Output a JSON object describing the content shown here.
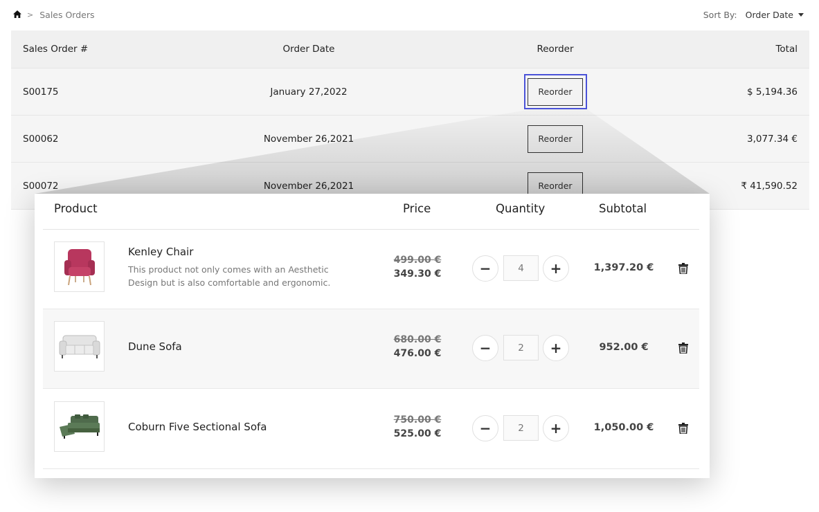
{
  "breadcrumb": {
    "home_icon": "home-icon",
    "separator": ">",
    "current": "Sales Orders"
  },
  "sort": {
    "label": "Sort By:",
    "value": "Order Date"
  },
  "orders": {
    "headers": {
      "number": "Sales Order #",
      "date": "Order Date",
      "reorder": "Reorder",
      "total": "Total"
    },
    "rows": [
      {
        "number": "S00175",
        "date": "January 27,2022",
        "reorder_label": "Reorder",
        "total": "$ 5,194.36"
      },
      {
        "number": "S00062",
        "date": "November 26,2021",
        "reorder_label": "Reorder",
        "total": "3,077.34 €"
      },
      {
        "number": "S00072",
        "date": "November 26,2021",
        "reorder_label": "Reorder",
        "total": "₹ 41,590.52"
      }
    ]
  },
  "cart": {
    "headers": {
      "product": "Product",
      "price": "Price",
      "quantity": "Quantity",
      "subtotal": "Subtotal"
    },
    "items": [
      {
        "name": "Kenley Chair",
        "description": "This product not only comes with an Aesthetic Design but is also comfortable and ergonomic.",
        "old_price": "499.00 €",
        "price": "349.30 €",
        "quantity": "4",
        "subtotal": "1,397.20 €",
        "image": "armchair-image"
      },
      {
        "name": "Dune Sofa",
        "description": "",
        "old_price": "680.00 €",
        "price": "476.00 €",
        "quantity": "2",
        "subtotal": "952.00 €",
        "image": "sofa-image"
      },
      {
        "name": "Coburn Five Sectional Sofa",
        "description": "",
        "old_price": "750.00 €",
        "price": "525.00 €",
        "quantity": "2",
        "subtotal": "1,050.00 €",
        "image": "sectional-sofa-image"
      }
    ],
    "minus_symbol": "−",
    "plus_symbol": "+"
  },
  "colors": {
    "focus_ring": "#4a52d8",
    "table_bg": "#f5f5f5",
    "text": "#222222"
  }
}
